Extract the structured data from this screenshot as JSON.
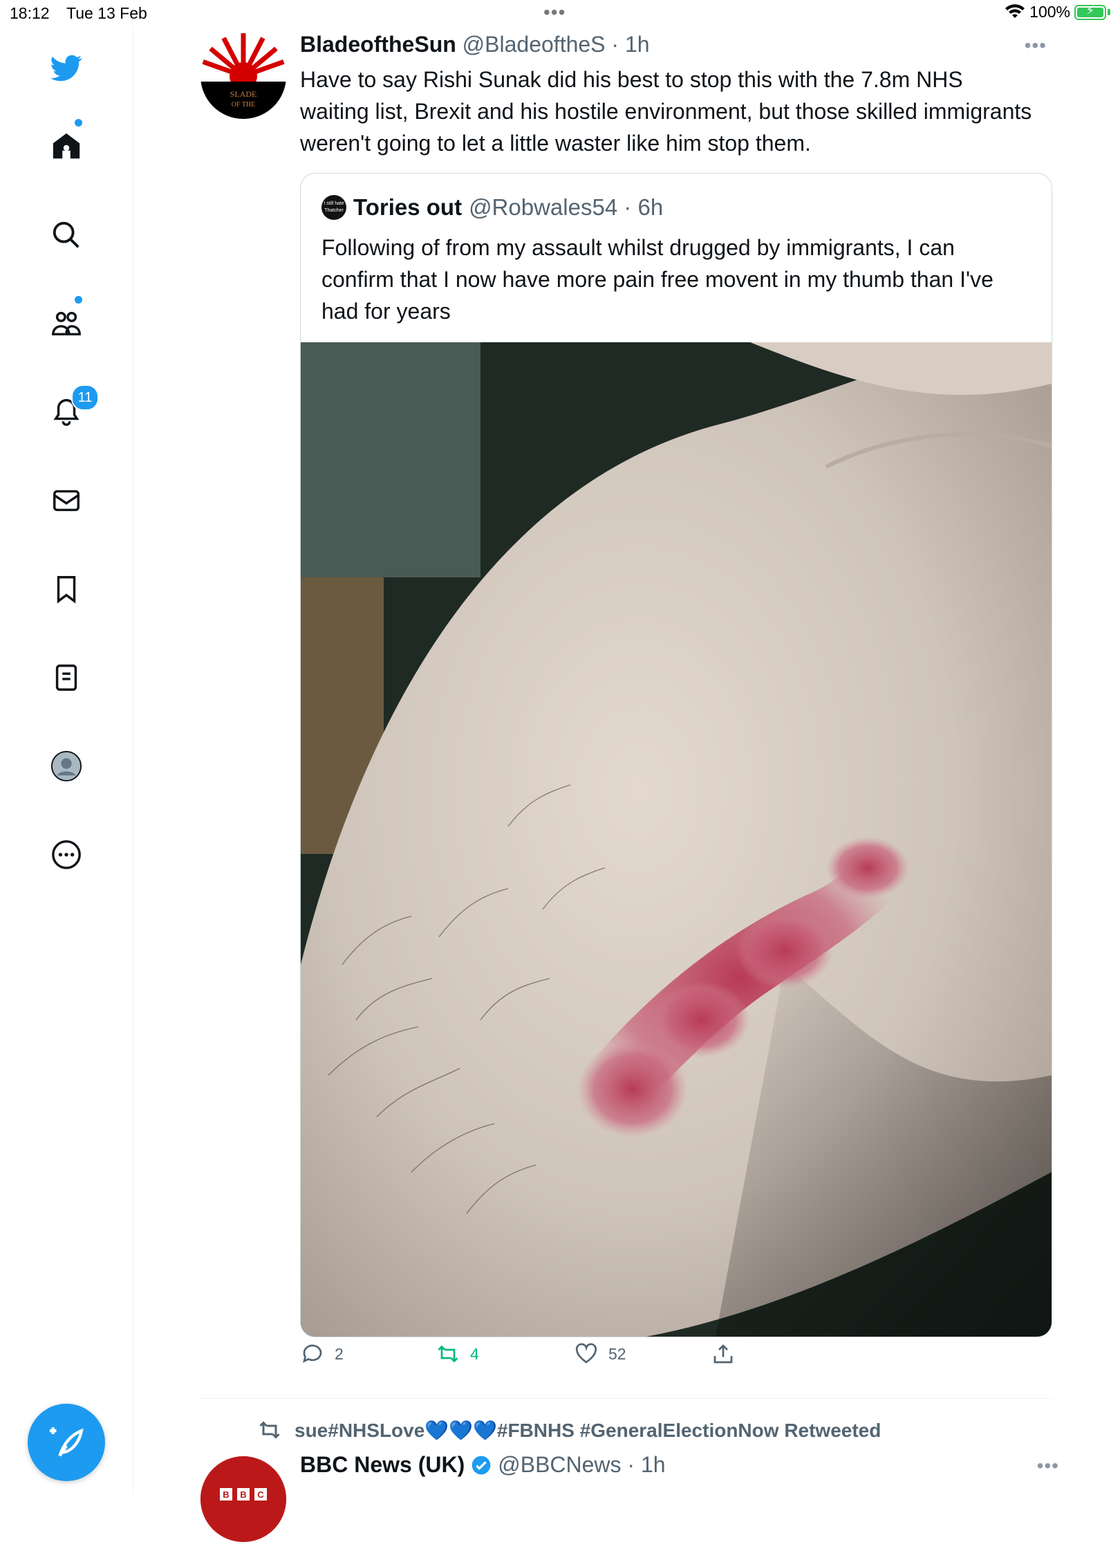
{
  "status_bar": {
    "time": "18:12",
    "date": "Tue 13 Feb",
    "battery": "100%"
  },
  "sidebar": {
    "icons": [
      "twitter-logo-icon",
      "home-icon",
      "search-icon",
      "communities-icon",
      "bell-icon",
      "mail-icon",
      "bookmark-icon",
      "lists-icon",
      "profile-icon",
      "more-icon"
    ],
    "notifications_badge": "11",
    "compose_label": "+"
  },
  "tweet": {
    "display_name": "BladeoftheSun",
    "handle_time": "@BladeoftheS · 1h",
    "avatar_text": "Blade of the Sun",
    "text": "Have to say Rishi Sunak did his best to stop this with the 7.8m NHS waiting list, Brexit and his hostile environment, but those skilled immigrants weren't going to let a little waster like him stop them.",
    "quote": {
      "display_name": "Tories out",
      "handle_time": "@Robwales54 · 6h",
      "avatar_text": "I still hate Thatcher",
      "text": "Following of from my assault whilst drugged by immigrants, I can confirm that I now have more pain free movent in my thumb than I've had for years"
    },
    "actions": {
      "replies": "2",
      "retweets": "4",
      "likes": "52"
    }
  },
  "retweet_notice": {
    "text": "sue#NHSLove💙💙💙#FBNHS #GeneralElectionNow Retweeted"
  },
  "next_tweet": {
    "display_name": "BBC News (UK)",
    "handle_time": "@BBCNews · 1h",
    "avatar_text": "BBC"
  },
  "colors": {
    "brand": "#1d9bf0",
    "retweet_green": "#00ba7c",
    "secondary_text": "#536471"
  }
}
